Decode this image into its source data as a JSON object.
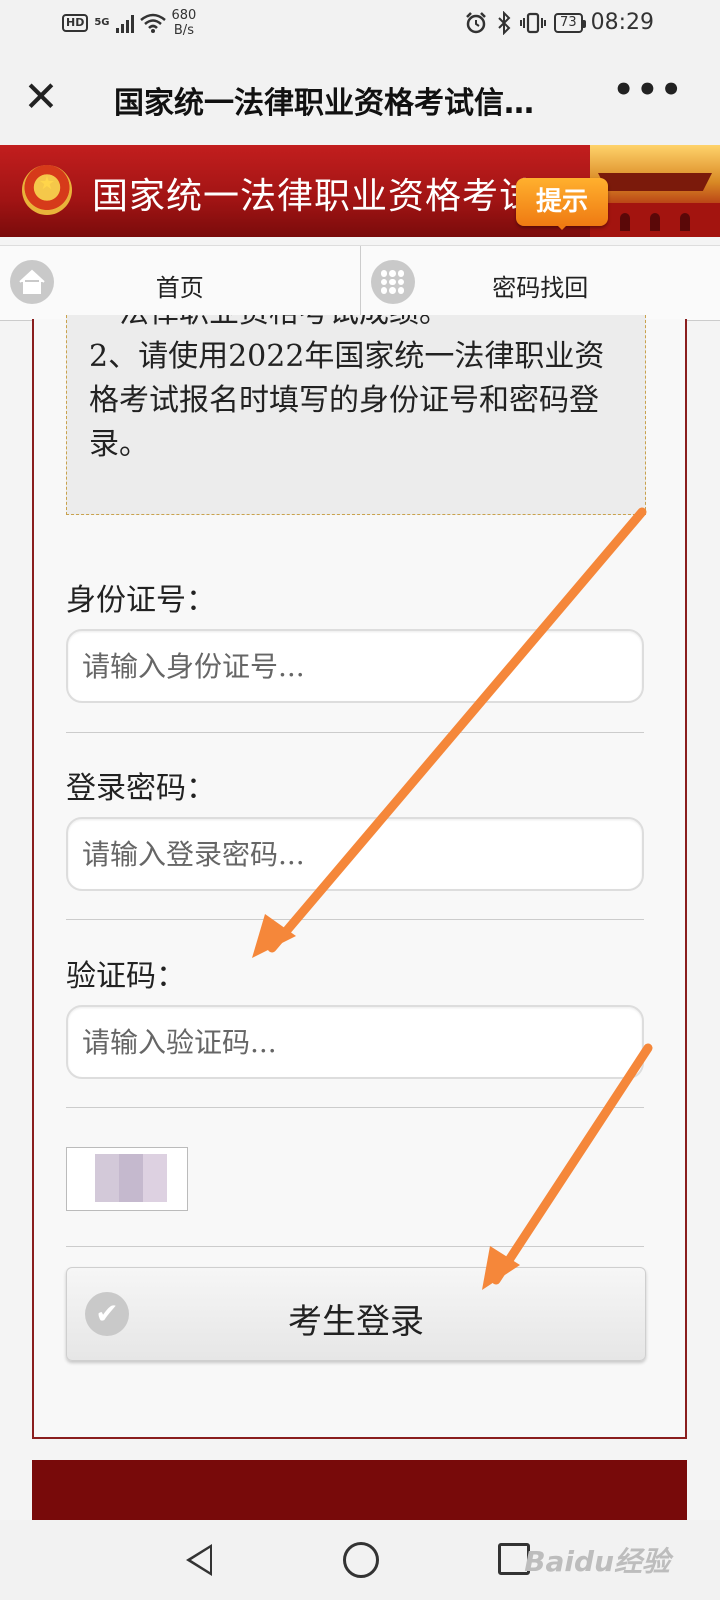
{
  "status_bar": {
    "hd": "HD",
    "network": "5G",
    "net_speed_value": "680",
    "net_speed_unit": "B/s",
    "battery": "73",
    "time": "08:29"
  },
  "titlebar": {
    "title": "国家统一法律职业资格考试信…"
  },
  "banner": {
    "text": "国家统一法律职业资格考试",
    "tip_badge": "提示"
  },
  "tabs": [
    {
      "label": "首页"
    },
    {
      "label": "密码找回"
    }
  ],
  "notice": {
    "partial_line": "一法律职业资格考试成绩。",
    "item2": "2、请使用2022年国家统一法律职业资格考试报名时填写的身份证号和密码登录。"
  },
  "form": {
    "id_label": "身份证号：",
    "id_placeholder": "请输入身份证号...",
    "password_label": "登录密码：",
    "password_placeholder": "请输入登录密码...",
    "captcha_label": "验证码：",
    "captcha_placeholder": "请输入验证码...",
    "login_button": "考生登录"
  },
  "nav": {
    "watermark": "Baidu经验"
  },
  "colors": {
    "banner_red": "#a11414",
    "panel_border": "#8a1e1e",
    "footer_red": "#780a0a",
    "arrow_orange": "#f5873a",
    "badge_orange": "#ef7a12"
  },
  "icons": {
    "close": "close-icon",
    "more": "more-icon",
    "home": "home-icon",
    "grid": "grid-icon",
    "check": "check-icon"
  }
}
